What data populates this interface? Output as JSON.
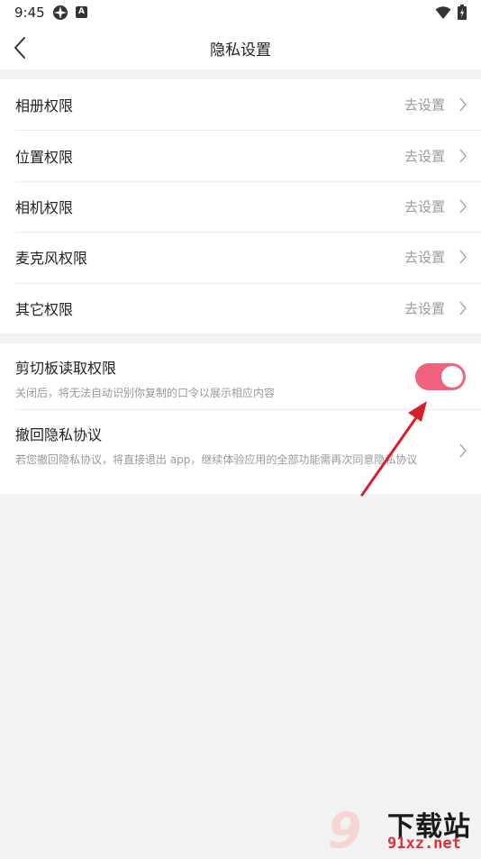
{
  "status_bar": {
    "time": "9:45",
    "notification_letter": "A"
  },
  "nav": {
    "title": "隐私设置"
  },
  "permissions": [
    {
      "label": "相册权限",
      "action": "去设置"
    },
    {
      "label": "位置权限",
      "action": "去设置"
    },
    {
      "label": "相机权限",
      "action": "去设置"
    },
    {
      "label": "麦克风权限",
      "action": "去设置"
    },
    {
      "label": "其它权限",
      "action": "去设置"
    }
  ],
  "clipboard": {
    "title": "剪切板读取权限",
    "description": "关闭后，将无法自动识别你复制的口令以展示相应内容",
    "enabled": true
  },
  "revoke": {
    "title": "撤回隐私协议",
    "description": "若您撤回隐私协议，将直接退出 app，继续体验应用的全部功能需再次同意隐私协议"
  },
  "watermark": {
    "brand": "下载站",
    "url": "91xz.net"
  },
  "colors": {
    "accent": "#f0627e",
    "annotation": "#d8202a",
    "background": "#f2f2f2"
  },
  "icons": {
    "back": "back-arrow-icon",
    "chevron": "chevron-right-icon",
    "wifi": "wifi-icon",
    "battery": "battery-icon"
  }
}
